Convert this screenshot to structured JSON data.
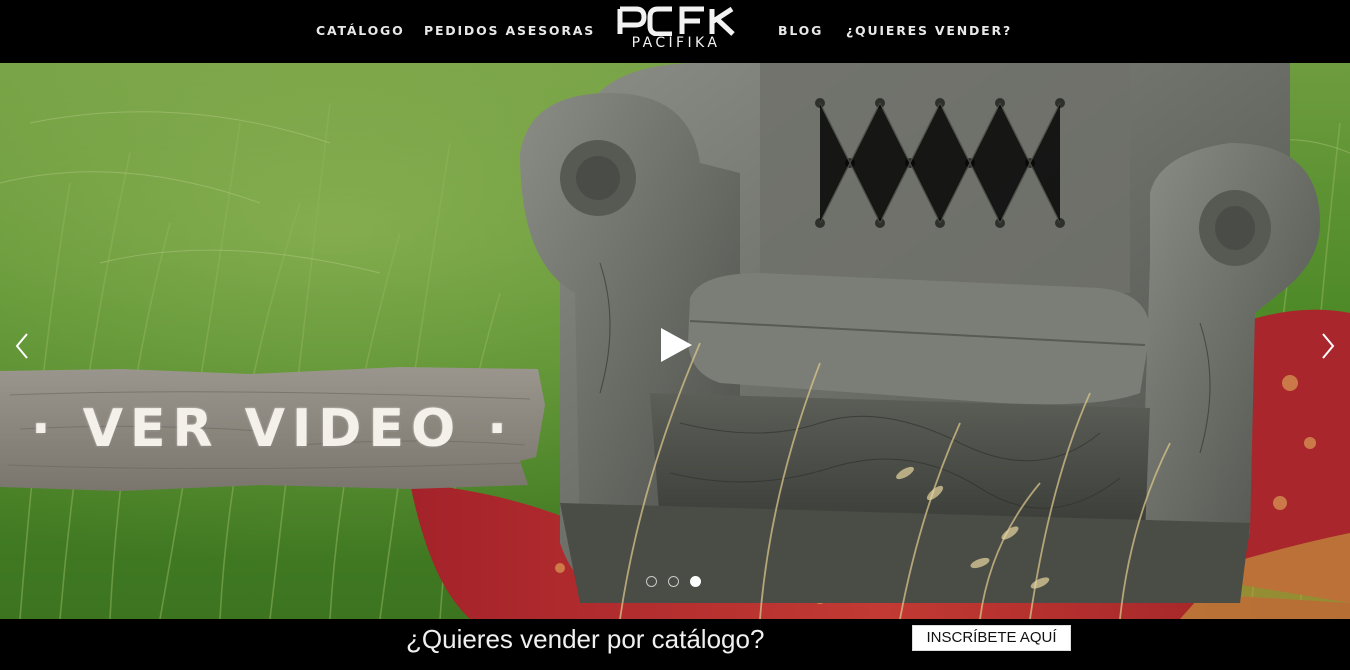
{
  "nav": {
    "catalogo": "CATÁLOGO",
    "pedidos": "PEDIDOS ASESORAS",
    "blog": "BLOG",
    "vender": "¿QUIERES VENDER?"
  },
  "logo": {
    "mark": "PCFK",
    "wordmark": "PACIFIKA"
  },
  "hero": {
    "overlay_label": "· VER VIDEO ·",
    "slides_total": 3,
    "active_slide": 3,
    "prev_icon": "chevron-left-icon",
    "next_icon": "chevron-right-icon",
    "play_icon": "play-icon"
  },
  "promo": {
    "text": "¿Quieres vender por catálogo?",
    "cta": "INSCRÍBETE AQUÍ"
  },
  "colors": {
    "nav_bg": "#000000",
    "nav_text": "#e8e8e8",
    "grass": "#4f8a2c",
    "sofa": "#6b6e67",
    "rug_red": "#b4232a",
    "cta_bg": "#ffffff"
  }
}
